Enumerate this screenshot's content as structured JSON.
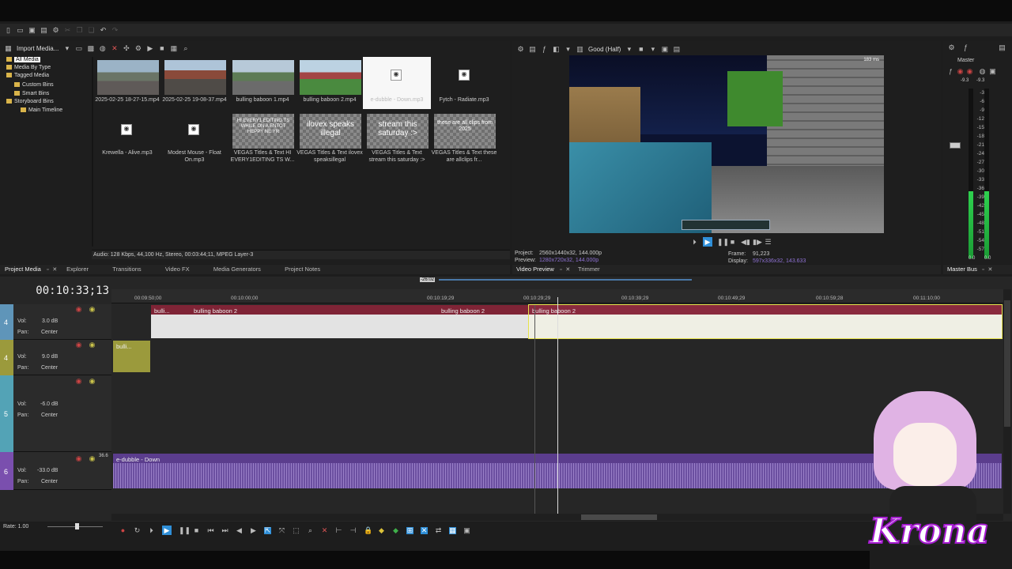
{
  "media": {
    "import_label": "Import Media...",
    "tree": [
      "All Media",
      "Media By Type",
      "Tagged Media",
      "Custom Bins",
      "Smart Bins",
      "Storyboard Bins",
      "Main Timeline"
    ],
    "items": [
      {
        "name": "2025-02-25 18-27-15.mp4",
        "kind": "video"
      },
      {
        "name": "2025-02-25 19-08-37.mp4",
        "kind": "video"
      },
      {
        "name": "bulling baboon 1.mp4",
        "kind": "video"
      },
      {
        "name": "bulling baboon 2.mp4",
        "kind": "video"
      },
      {
        "name": "e-dubble - Down.mp3",
        "kind": "audio",
        "selected": true
      },
      {
        "name": "Fytch - Radiate.mp3",
        "kind": "audio"
      },
      {
        "name": "Krewella - Alive.mp3",
        "kind": "audio"
      },
      {
        "name": "Modest Mouse - Float On.mp3",
        "kind": "audio"
      },
      {
        "name": "VEGAS Titles & Text HI EVERY1EDITING TS W...",
        "kind": "title",
        "preview": "HI EVERY1 EDITING TS WHILE ON A ENTOT HEPPY NE YR"
      },
      {
        "name": "VEGAS Titles & Text ilovex speaksillegal",
        "kind": "title",
        "preview": "ilovex speaks illegal"
      },
      {
        "name": "VEGAS Titles & Text stream this saturday :>",
        "kind": "title",
        "preview": "stream this saturday :>"
      },
      {
        "name": "VEGAS Titles & Text these are allclips fr...",
        "kind": "title",
        "preview": "these are all clips from 2025"
      }
    ],
    "status": "Audio: 128 Kbps, 44,100 Hz, Stereo, 00:03:44;11, MPEG Layer-3",
    "tabs": [
      "Project Media",
      "Explorer",
      "Transitions",
      "Video FX",
      "Media Generators",
      "Project Notes"
    ]
  },
  "preview": {
    "quality": "Good (Half)",
    "project_label": "Project:",
    "project_value": "2560x1440x32, 144.000p",
    "preview_label": "Preview:",
    "preview_value": "1280x720x32, 144.000p",
    "frame_label": "Frame:",
    "frame_value": "91,223",
    "display_label": "Display:",
    "display_value": "597x336x32, 143.633",
    "tabs": [
      "Video Preview",
      "Trimmer"
    ],
    "game_fps": "183 ms"
  },
  "master": {
    "title": "Master",
    "db_left": "-9.3",
    "db_right": "-9.3",
    "scale": [
      "3",
      "6",
      "9",
      "12",
      "15",
      "18",
      "21",
      "24",
      "27",
      "30",
      "33",
      "36",
      "39",
      "42",
      "45",
      "48",
      "51",
      "54",
      "57"
    ],
    "bottom_left": "0.0",
    "bottom_right": "0.0",
    "tab": "Master Bus"
  },
  "timeline": {
    "timecode": "00:10:33;13",
    "ruler_marker": "-26:02",
    "ruler": [
      "00:09:50;00",
      "00:10:00;00",
      "00:10:19;29",
      "00:10:29;29",
      "00:10:39;29",
      "00:10:49;29",
      "00:10:59;28",
      "00:11:10;00"
    ],
    "tracks": [
      {
        "num": "4",
        "vol_label": "Vol:",
        "vol": "3.0 dB",
        "pan_label": "Pan:",
        "pan": "Center"
      },
      {
        "num": "4",
        "vol_label": "Vol:",
        "vol": "9.0 dB",
        "pan_label": "Pan:",
        "pan": "Center"
      },
      {
        "num": "5",
        "vol_label": "Vol:",
        "vol": "-6.0 dB",
        "pan_label": "Pan:",
        "pan": "Center"
      },
      {
        "num": "6",
        "vol_label": "Vol:",
        "vol": "-33.0 dB",
        "pan_label": "Pan:",
        "pan": "Center"
      }
    ],
    "clips": {
      "c1": "bulli...",
      "c2": "bulling baboon 2",
      "c3": "bulling baboon 2",
      "c4": "bulling baboon 2",
      "c5": "bulli...",
      "c6": "e-dubble - Down"
    },
    "audio_level": "36.6",
    "rate_label": "Rate: 1.00"
  },
  "overlay": {
    "watermark": "Krona"
  },
  "colors": {
    "video_clip": "#8a2a3e",
    "title_clip": "#9b9a3c",
    "audio_clip": "#5b3d8d",
    "accent": "#2f8fd8"
  }
}
